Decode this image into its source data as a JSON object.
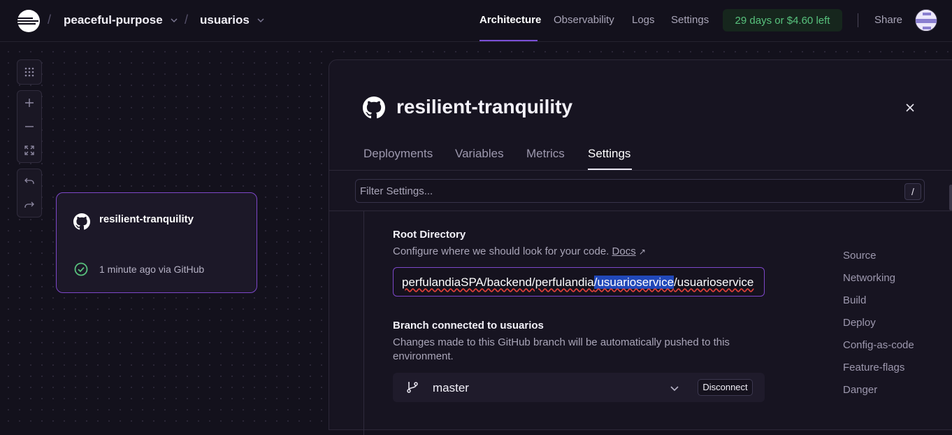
{
  "header": {
    "project": "peaceful-purpose",
    "environment": "usuarios",
    "nav": [
      "Architecture",
      "Observability",
      "Logs",
      "Settings"
    ],
    "active_nav": "Architecture",
    "trial": "29 days or $4.60 left",
    "share": "Share",
    "separator": "/"
  },
  "canvas": {
    "tools": [
      "grid-icon",
      "zoom-in-icon",
      "zoom-out-icon",
      "fit-screen-icon",
      "undo-icon",
      "redo-icon"
    ],
    "card": {
      "title": "resilient-tranquility",
      "status": "1 minute ago via GitHub"
    }
  },
  "panel": {
    "title": "resilient-tranquility",
    "tabs": [
      "Deployments",
      "Variables",
      "Metrics",
      "Settings"
    ],
    "active_tab": "Settings",
    "filter": {
      "placeholder": "Filter Settings...",
      "shortcut": "/"
    },
    "root_directory": {
      "title": "Root Directory",
      "description": "Configure where we should look for your code.",
      "docs": "Docs",
      "docs_arrow": "↗",
      "value_before": "perfulandiaSPA/backend/perfulandia",
      "value_selected": "/usuarioservice",
      "value_after": "/usuarioservice"
    },
    "branch": {
      "title": "Branch connected to usuarios",
      "description_line1": "Changes made to this GitHub branch will be automatically pushed to this",
      "description_line2": "environment.",
      "name": "master",
      "disconnect": "Disconnect"
    },
    "side_nav": [
      "Source",
      "Networking",
      "Build",
      "Deploy",
      "Config-as-code",
      "Feature-flags",
      "Danger"
    ]
  },
  "colors": {
    "accent": "#7d47c9",
    "trial_text": "#58c27d",
    "success": "#58c27d",
    "selection": "#2148b9"
  }
}
